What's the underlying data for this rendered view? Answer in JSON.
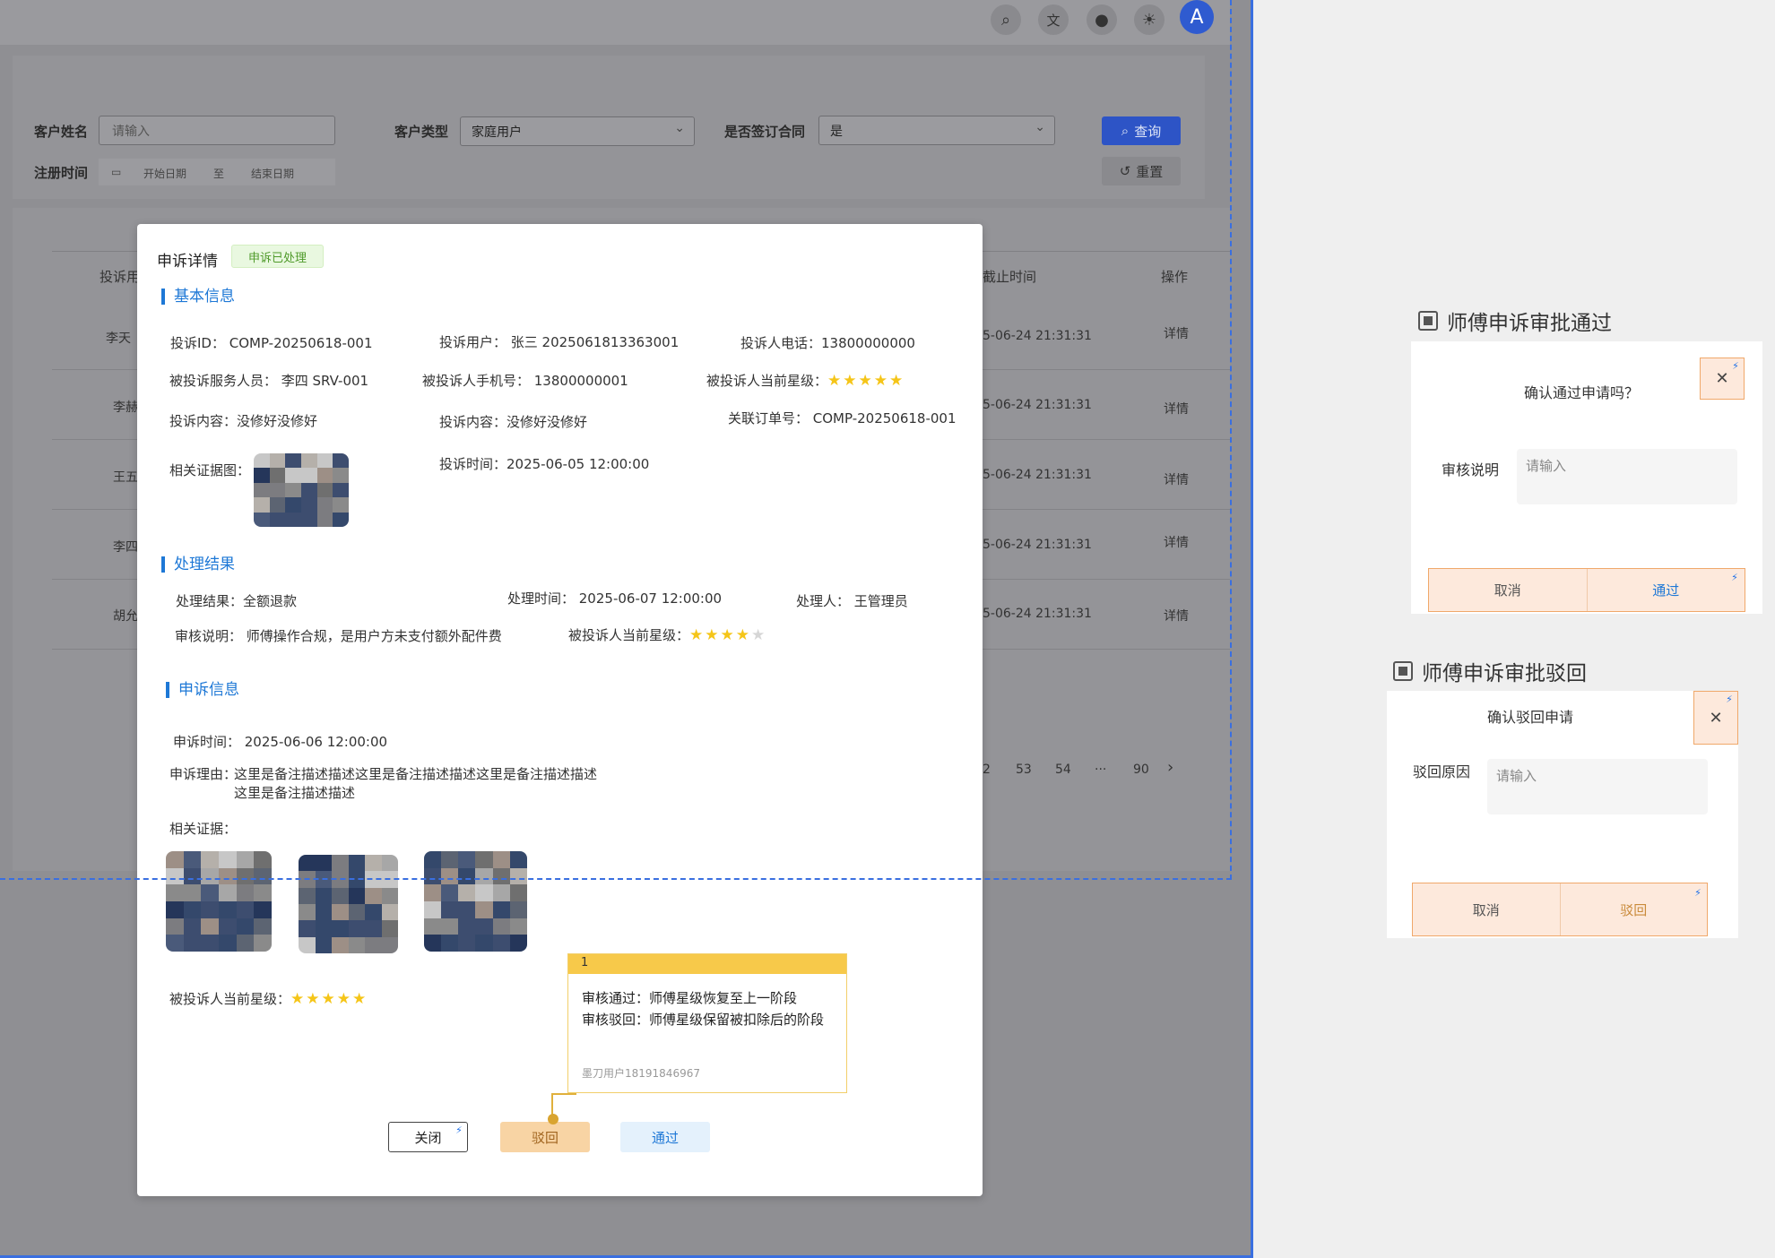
{
  "header": {
    "icons": [
      "search-icon",
      "translate-icon",
      "notification-icon",
      "theme-icon"
    ],
    "avatar_letter": "A"
  },
  "filters": {
    "customer_name_label": "客户姓名",
    "customer_name_placeholder": "请输入",
    "customer_type_label": "客户类型",
    "customer_type_value": "家庭用户",
    "contract_label": "是否签订合同",
    "contract_value": "是",
    "register_time_label": "注册时间",
    "date_start": "开始日期",
    "date_sep": "至",
    "date_end": "结束日期",
    "query_label": "查询",
    "reset_label": "重置"
  },
  "table": {
    "col_complainant": "投诉用",
    "col_deadline": "截止时间",
    "col_action": "操作",
    "rows": [
      {
        "name": "李天",
        "deadline": "5-06-24 21:31:31",
        "action": "详情"
      },
      {
        "name": "李赫",
        "deadline": "5-06-24 21:31:31",
        "action": "详情"
      },
      {
        "name": "王五",
        "deadline": "5-06-24 21:31:31",
        "action": "详情"
      },
      {
        "name": "李四",
        "deadline": "5-06-24 21:31:31",
        "action": "详情"
      },
      {
        "name": "胡允",
        "deadline": "5-06-24 21:31:31",
        "action": "详情"
      }
    ],
    "pager": [
      "2",
      "53",
      "54",
      "···",
      "90",
      "›"
    ]
  },
  "modal": {
    "title": "申诉详情",
    "status": "申诉已处理",
    "basic_section": "基本信息",
    "basic": {
      "complaint_id": "投诉ID： COMP-20250618-001",
      "complaint_user": "投诉用户：  张三 2025061813363001",
      "complainant_phone": "投诉人电话：13800000000",
      "service_staff": "被投诉服务人员：  李四  SRV-001",
      "staff_phone": "被投诉人手机号：  13800000001",
      "staff_level_label": "被投诉人当前星级：",
      "content_1": "投诉内容：没修好没修好",
      "content_2": "投诉内容：没修好没修好",
      "order_no": "关联订单号：  COMP-20250618-001",
      "evidence_label": "相关证据图：",
      "complaint_time": "投诉时间：2025-06-05 12:00:00"
    },
    "process_section": "处理结果",
    "process": {
      "result": "处理结果：全额退款",
      "process_time": "处理时间：  2025-06-07 12:00:00",
      "handler": "处理人：  王管理员",
      "review_note": "审核说明：  师傅操作合规，是用户方未支付额外配件费",
      "staff_level_label": "被投诉人当前星级："
    },
    "appeal_section": "申诉信息",
    "appeal": {
      "appeal_time": "申诉时间：  2025-06-06 12:00:00",
      "reason_label": "申诉理由：",
      "reason_line1": "这里是备注描述描述这里是备注描述描述这里是备注描述描述",
      "reason_line2": "这里是备注描述描述",
      "evidence_label": "相关证据：",
      "staff_level_label": "被投诉人当前星级："
    },
    "ratings": {
      "basic_stars": 5,
      "process_stars": 4,
      "appeal_stars": 5
    },
    "buttons": {
      "close": "关闭",
      "reject": "驳回",
      "approve": "通过"
    }
  },
  "note": {
    "number": "1",
    "line1": "审核通过：师傅星级恢复至上一阶段",
    "line2": "审核驳回：师傅星级保留被扣除后的阶段",
    "author": "墨刀用户18191846967"
  },
  "approve_dialog": {
    "heading": "师傅申诉审批通过",
    "question": "确认通过申请吗？",
    "field_label": "审核说明",
    "placeholder": "请输入",
    "cancel": "取消",
    "confirm": "通过"
  },
  "reject_dialog": {
    "heading": "师傅申诉审批驳回",
    "question": "确认驳回申请",
    "field_label": "驳回原因",
    "placeholder": "请输入",
    "cancel": "取消",
    "confirm": "驳回"
  },
  "colors": {
    "primary": "#1e78d6",
    "star": "#f5c518",
    "reject": "#f8d4a4",
    "approve_bg": "#e4f1fc"
  }
}
